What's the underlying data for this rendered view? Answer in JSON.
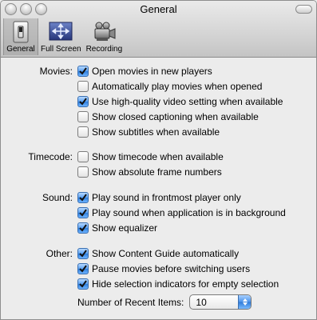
{
  "window": {
    "title": "General"
  },
  "toolbar": {
    "items": [
      {
        "label": "General",
        "icon": "switch-icon",
        "selected": true
      },
      {
        "label": "Full Screen",
        "icon": "fullscreen-icon",
        "selected": false
      },
      {
        "label": "Recording",
        "icon": "video-camera-icon",
        "selected": false
      }
    ]
  },
  "movies": {
    "label": "Movies:",
    "options": [
      {
        "text": "Open movies in new players",
        "checked": true
      },
      {
        "text": "Automatically play movies when opened",
        "checked": false
      },
      {
        "text": "Use high-quality video setting when available",
        "checked": true
      },
      {
        "text": "Show closed captioning when available",
        "checked": false
      },
      {
        "text": "Show subtitles when available",
        "checked": false
      }
    ]
  },
  "timecode": {
    "label": "Timecode:",
    "options": [
      {
        "text": "Show timecode when available",
        "checked": false
      },
      {
        "text": "Show absolute frame numbers",
        "checked": false
      }
    ]
  },
  "sound": {
    "label": "Sound:",
    "options": [
      {
        "text": "Play sound in frontmost player only",
        "checked": true
      },
      {
        "text": "Play sound when application is in background",
        "checked": true
      },
      {
        "text": "Show equalizer",
        "checked": true
      }
    ]
  },
  "other": {
    "label": "Other:",
    "options": [
      {
        "text": "Show Content Guide automatically",
        "checked": true
      },
      {
        "text": "Pause movies before switching users",
        "checked": true
      },
      {
        "text": "Hide selection indicators for empty selection",
        "checked": true
      }
    ]
  },
  "recent_items": {
    "label": "Number of Recent Items:",
    "value": "10"
  },
  "colors": {
    "accent": "#3a87e8"
  }
}
